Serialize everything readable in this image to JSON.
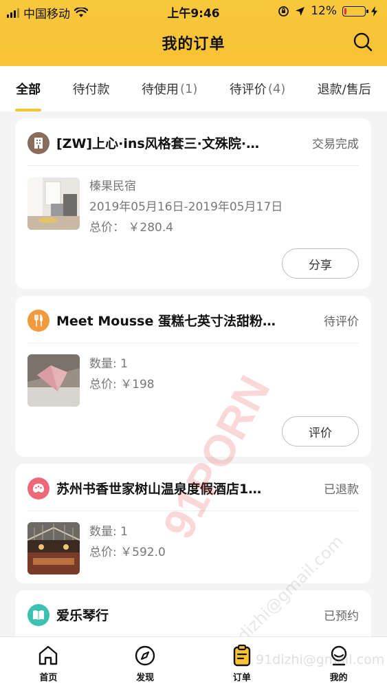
{
  "status_bar": {
    "carrier": "中国移动",
    "time": "上午9:46",
    "battery": "12%",
    "battery_level": 0.12
  },
  "header": {
    "title": "我的订单"
  },
  "tabs": [
    {
      "label": "全部",
      "count": ""
    },
    {
      "label": "待付款",
      "count": ""
    },
    {
      "label": "待使用",
      "count": "(1)"
    },
    {
      "label": "待评价",
      "count": "(4)"
    },
    {
      "label": "退款/售后",
      "count": ""
    }
  ],
  "orders": [
    {
      "icon": "building-icon",
      "icon_color": "#8b6b5c",
      "shop_name": "[ZW]上心·ins风格套三·文殊院·…",
      "status": "交易完成",
      "lines": [
        "榛果民宿",
        "2019年05月16日-2019年05月17日",
        "总价：  ￥280.4"
      ],
      "action": "分享"
    },
    {
      "icon": "fork-knife-icon",
      "icon_color": "#f29a3c",
      "shop_name": "Meet Mousse 蛋糕七英寸法甜粉…",
      "status": "待评价",
      "lines": [
        "数量: 1",
        "总价: ￥198"
      ],
      "action": "评价"
    },
    {
      "icon": "game-controller-icon",
      "icon_color": "#ec6a78",
      "shop_name": "苏州书香世家树山温泉度假酒店1…",
      "status": "已退款",
      "lines": [
        "数量:  1",
        "总价: ￥592.0"
      ],
      "action": ""
    },
    {
      "icon": "book-icon",
      "icon_color": "#3dc1b1",
      "shop_name": "爱乐琴行",
      "status": "已预约",
      "lines": [],
      "action": ""
    }
  ],
  "bottom_nav": [
    {
      "label": "首页",
      "icon": "home-icon"
    },
    {
      "label": "发现",
      "icon": "compass-icon"
    },
    {
      "label": "订单",
      "icon": "order-clipboard-icon",
      "active": true
    },
    {
      "label": "我的",
      "icon": "profile-icon"
    }
  ],
  "watermark": {
    "big": "91PORN",
    "small": "91dizhi@gmail.com",
    "small2": "91dizhi@gmail.com"
  },
  "colors": {
    "accent": "#f7c233",
    "background": "#f4f4f5"
  }
}
